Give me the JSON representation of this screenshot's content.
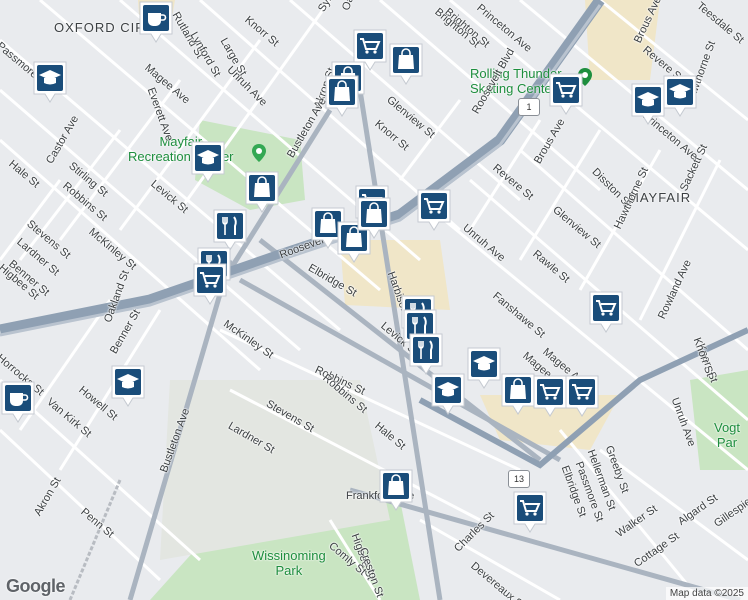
{
  "map": {
    "neighborhoods": [
      {
        "name": "OXFORD CIR"
      },
      {
        "name": "MAYFAIR"
      }
    ],
    "parks": [
      {
        "name": "Mayfair Recreation Center",
        "lines": [
          "Mayfair",
          "Recreation Center"
        ]
      },
      {
        "name": "Wissinoming Park",
        "lines": [
          "Wissinoming",
          "Park"
        ]
      },
      {
        "name": "Vogt Park",
        "lines": [
          "Vogt Par"
        ]
      }
    ],
    "pois": [
      {
        "name": "Rolling Thunder Skating Center",
        "lines": [
          "Rolling Thunder",
          "Skating Center"
        ]
      }
    ],
    "streets": [
      "Knorr St",
      "Rutland St",
      "Lynford St",
      "Large St",
      "Unruh Ave",
      "Sylvester St",
      "Oakland St",
      "Brighton St",
      "Princeton Ave",
      "Passmore St",
      "Magee Ave",
      "Everett Ave",
      "Akron St",
      "Glenview St",
      "Knorr St",
      "Bustleton Ave",
      "Castor Ave",
      "Hale St",
      "Stirling St",
      "Robbins St",
      "Levick St",
      "McKinley St",
      "Stevens St",
      "Lardner St",
      "Benner St",
      "Higbee St",
      "Roosevelt Blvd",
      "Elbridge St",
      "Unruh Ave",
      "Brous Ave",
      "Revere St",
      "Disston St",
      "Glenview St",
      "Rawle St",
      "Hawthorne St",
      "Sackett St",
      "Fanshawe St",
      "Rowland Ave",
      "Magee Ave",
      "Knorr St",
      "McKinley St",
      "Robbins St",
      "Stevens St",
      "Lardner St",
      "Hale St",
      "Oakland St",
      "Benner St",
      "Howell St",
      "Van Kirk St",
      "Horrocks St",
      "Bustleton Ave",
      "Akron St",
      "Penn St",
      "Frankford Ave",
      "Higbee St",
      "Creston St",
      "Comly St",
      "Charles St",
      "Devereaux St",
      "Greeby St",
      "Hellerman St",
      "Passmore St",
      "Elbridge St",
      "Walker St",
      "Algard St",
      "Cottage St",
      "Gillespie St",
      "Magee Ave",
      "Unruh Ave",
      "Knorr St",
      "Brighton St",
      "Teesdale St",
      "Revere St",
      "Brous Ave",
      "Hawthorne St",
      "Princeton Ave",
      "Roosevelt Blvd",
      "Levick St",
      "Harbison Ave",
      "Robbins St"
    ],
    "route_shields": [
      "1",
      "13"
    ],
    "markers": [
      {
        "icon": "coffee-icon"
      },
      {
        "icon": "shopping-cart-icon"
      },
      {
        "icon": "shopping-bag-icon"
      },
      {
        "icon": "shopping-bag-icon"
      },
      {
        "icon": "shopping-bag-icon"
      },
      {
        "icon": "graduation-cap-icon"
      },
      {
        "icon": "shopping-cart-icon"
      },
      {
        "icon": "graduation-cap-icon"
      },
      {
        "icon": "graduation-cap-icon"
      },
      {
        "icon": "graduation-cap-icon"
      },
      {
        "icon": "shopping-bag-icon"
      },
      {
        "icon": "restaurant-icon"
      },
      {
        "icon": "shopping-cart-icon"
      },
      {
        "icon": "shopping-bag-icon"
      },
      {
        "icon": "shopping-bag-icon"
      },
      {
        "icon": "shopping-cart-icon"
      },
      {
        "icon": "restaurant-icon"
      },
      {
        "icon": "shopping-cart-icon"
      },
      {
        "icon": "shopping-cart-icon"
      },
      {
        "icon": "restaurant-icon"
      },
      {
        "icon": "restaurant-icon"
      },
      {
        "icon": "restaurant-icon"
      },
      {
        "icon": "graduation-cap-icon"
      },
      {
        "icon": "graduation-cap-icon"
      },
      {
        "icon": "shopping-bag-icon"
      },
      {
        "icon": "shopping-cart-icon"
      },
      {
        "icon": "shopping-cart-icon"
      },
      {
        "icon": "graduation-cap-icon"
      },
      {
        "icon": "coffee-icon"
      },
      {
        "icon": "shopping-bag-icon"
      },
      {
        "icon": "shopping-cart-icon"
      },
      {
        "icon": "shopping-bag-icon"
      }
    ]
  },
  "branding": {
    "logo": "Google",
    "attribution": "Map data ©2025"
  },
  "colors": {
    "marker": "#1a4d7a",
    "park": "#c9e5c2",
    "highway": "#8fa0b3",
    "commercial": "#f0e6c8"
  }
}
